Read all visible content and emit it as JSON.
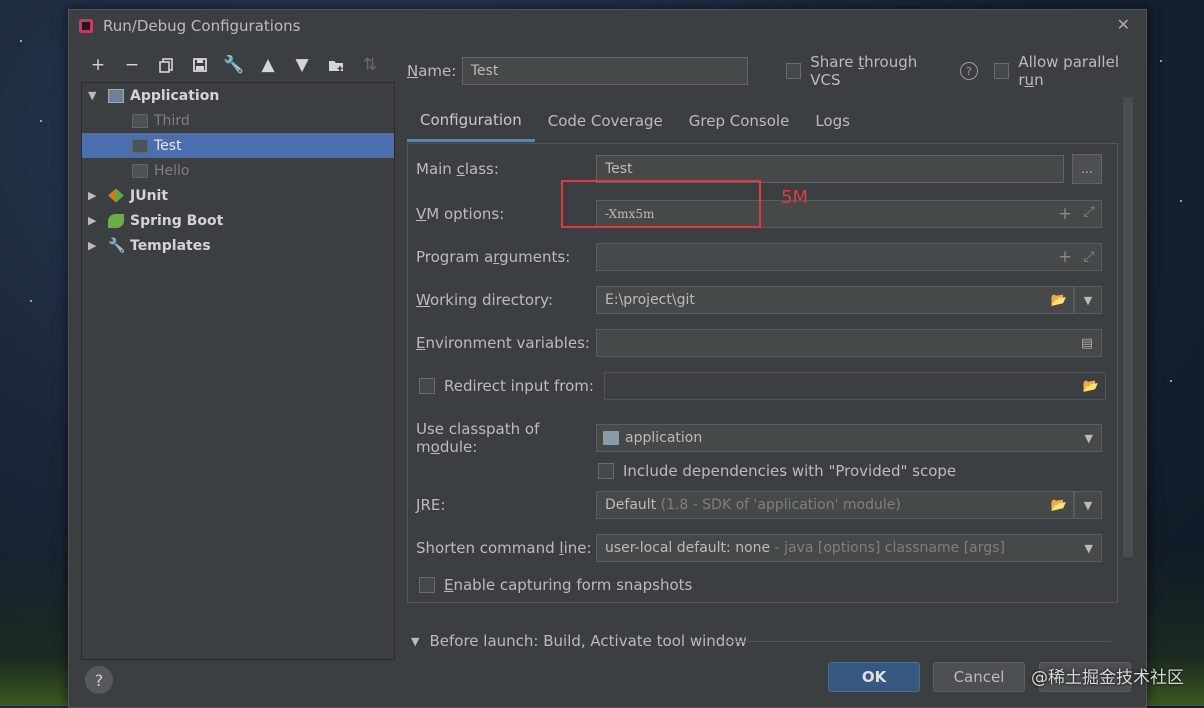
{
  "window": {
    "title": "Run/Debug Configurations",
    "close_glyph": "✕"
  },
  "toolbar": {
    "icons": [
      "add-icon",
      "remove-icon",
      "copy-icon",
      "save-icon",
      "wrench-icon",
      "move-up-icon",
      "move-down-icon",
      "new-folder-icon",
      "sort-icon"
    ]
  },
  "tree": {
    "application": "Application",
    "children": [
      "Third",
      "Test",
      "Hello"
    ],
    "selected": "Test",
    "junit": "JUnit",
    "spring_boot": "Spring Boot",
    "templates": "Templates"
  },
  "name_row": {
    "label_u": "N",
    "label_rest": "ame:",
    "value": "Test",
    "share_pre": "Share ",
    "share_u": "t",
    "share_post": "hrough VCS",
    "help": "?",
    "allow_pre": "Allow parallel r",
    "allow_u": "u",
    "allow_post": "n"
  },
  "tabs": [
    "Configuration",
    "Code Coverage",
    "Grep Console",
    "Logs"
  ],
  "form": {
    "main_class": {
      "pre": "Main ",
      "u": "c",
      "post": "lass:",
      "value": "Test",
      "btn": "..."
    },
    "vm_options": {
      "u": "V",
      "post": "M options:",
      "value": "-Xmx5m"
    },
    "program_args": {
      "pre": "Program a",
      "u": "r",
      "post": "guments:"
    },
    "working_dir": {
      "u": "W",
      "post": "orking directory:",
      "value": "E:\\project\\git"
    },
    "env_vars": {
      "u": "E",
      "post": "nvironment variables:"
    },
    "redirect": {
      "label": "Redirect input from:"
    },
    "classpath": {
      "pre": "Use classpath of m",
      "u": "o",
      "post": "dule:",
      "value": "application"
    },
    "include_deps": "Include dependencies with \"Provided\" scope",
    "jre": {
      "u": "J",
      "post": "RE:",
      "value": "Default",
      "hint": "(1.8 - SDK of 'application' module)"
    },
    "shorten": {
      "pre": "Shorten command ",
      "u": "l",
      "post": "ine:",
      "value": "user-local default: none",
      "hint": "- java [options] classname [args]"
    },
    "snapshots": {
      "u": "E",
      "post": "nable capturing form snapshots"
    }
  },
  "annotation": {
    "text": "5M",
    "color": "#e03a3a"
  },
  "before_launch": "Before launch: Build, Activate tool window",
  "buttons": {
    "ok": "OK",
    "cancel": "Cancel",
    "help": "?"
  },
  "watermark": "@稀土掘金技术社区",
  "colors": {
    "selection": "#4b6eaf",
    "tab_underline": "#4a88c7",
    "ok_button": "#365880"
  }
}
